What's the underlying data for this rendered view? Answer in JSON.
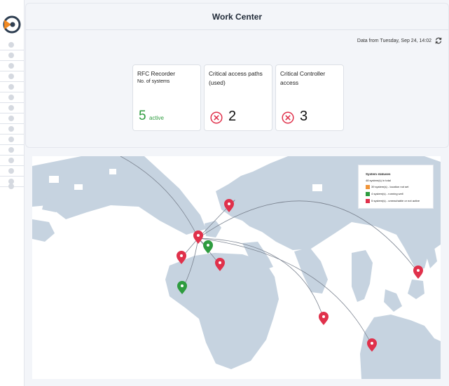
{
  "header": {
    "title": "Work Center",
    "data_from": "Data from Tuesday, Sep 24, 14:02"
  },
  "cards": [
    {
      "title": "RFC Recorder",
      "subtitle": "No. of systems",
      "value": "5",
      "value_label": "active"
    },
    {
      "title": "Critical access paths (used)",
      "value": "2"
    },
    {
      "title": "Critical Controller access",
      "value": "3"
    }
  ],
  "legend": {
    "title": "System statuses",
    "rows": [
      {
        "label": "48 system(s) in total",
        "color": ""
      },
      {
        "label": "39 system(s) - location not set",
        "color": "#f0953a"
      },
      {
        "label": "4 system(s) - running well",
        "color": "#2e9c3f"
      },
      {
        "label": "5 system(s) - unreachable or not active",
        "color": "#e0314b"
      }
    ]
  },
  "colors": {
    "green": "#2e9c3f",
    "red": "#e0314b",
    "land": "#c6d3e0",
    "arc": "#7b8390"
  },
  "icons": [
    "logo-icon",
    "refresh-icon",
    "error-circle-icon",
    "map-pin-icon"
  ]
}
